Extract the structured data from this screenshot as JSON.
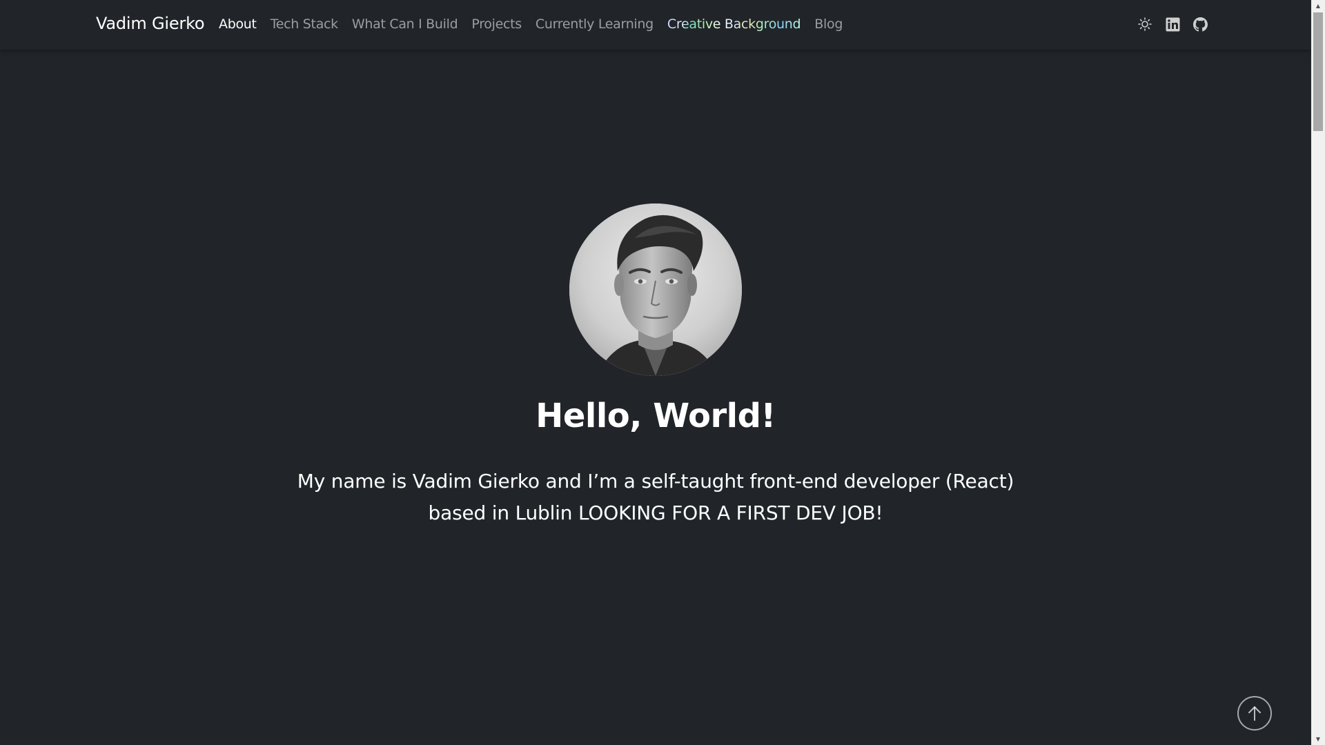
{
  "navbar": {
    "brand": "Vadim Gierko",
    "links": [
      {
        "label": "About",
        "active": true
      },
      {
        "label": "Tech Stack"
      },
      {
        "label": "What Can I Build"
      },
      {
        "label": "Projects"
      },
      {
        "label": "Currently Learning"
      },
      {
        "label": "Creative Background"
      },
      {
        "label": "Blog"
      }
    ],
    "icons": [
      "sun-icon",
      "linkedin-icon",
      "github-icon"
    ]
  },
  "hero": {
    "title": "Hello, World!",
    "intro_line1": "My name is Vadim Gierko and I’m a self-taught front-end developer (React)",
    "intro_line2": "based in Lublin LOOKING FOR A FIRST DEV JOB!"
  },
  "colors": {
    "background": "#212529",
    "text": "#ffffff",
    "nav_inactive": "rgba(255,255,255,0.55)"
  }
}
